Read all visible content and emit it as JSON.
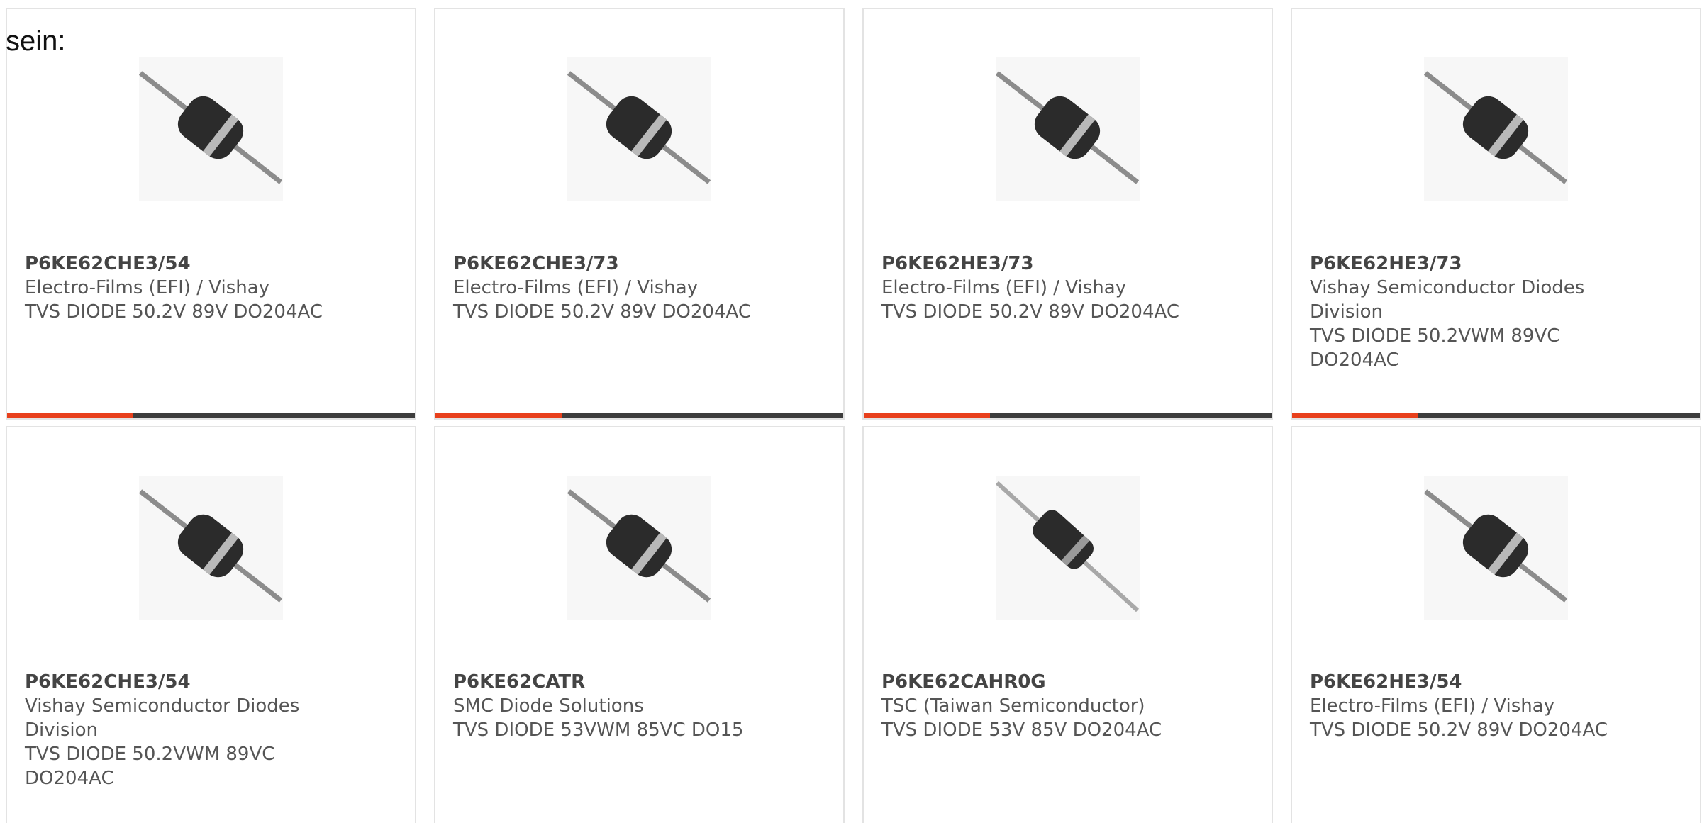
{
  "intro_text": "sein:",
  "colors": {
    "accent": "#e8401c",
    "bar_track": "#3d3d3d",
    "card_border": "#e3e3e3",
    "diode_body": "#2b2b2b",
    "diode_band": "#b9b9b9",
    "diode_lead": "#8c8c8c"
  },
  "products": [
    {
      "part_number": "P6KE62CHE3/54",
      "manufacturer": "Electro-Films (EFI) / Vishay",
      "description": "TVS DIODE 50.2V 89V DO204AC",
      "image_icon": "axial-diode-icon"
    },
    {
      "part_number": "P6KE62CHE3/73",
      "manufacturer": "Electro-Films (EFI) / Vishay",
      "description": "TVS DIODE 50.2V 89V DO204AC",
      "image_icon": "axial-diode-icon"
    },
    {
      "part_number": "P6KE62HE3/73",
      "manufacturer": "Electro-Films (EFI) / Vishay",
      "description": "TVS DIODE 50.2V 89V DO204AC",
      "image_icon": "axial-diode-icon"
    },
    {
      "part_number": "P6KE62HE3/73",
      "manufacturer": "Vishay Semiconductor Diodes Division",
      "description": "TVS DIODE 50.2VWM 89VC DO204AC",
      "image_icon": "axial-diode-icon"
    },
    {
      "part_number": "P6KE62CHE3/54",
      "manufacturer": "Vishay Semiconductor Diodes Division",
      "description": "TVS DIODE 50.2VWM 89VC DO204AC",
      "image_icon": "axial-diode-icon"
    },
    {
      "part_number": "P6KE62CATR",
      "manufacturer": "SMC Diode Solutions",
      "description": "TVS DIODE 53VWM 85VC DO15",
      "image_icon": "axial-diode-icon"
    },
    {
      "part_number": "P6KE62CAHR0G",
      "manufacturer": "TSC (Taiwan Semiconductor)",
      "description": "TVS DIODE 53V 85V DO204AC",
      "image_icon": "axial-diode-slim-icon"
    },
    {
      "part_number": "P6KE62HE3/54",
      "manufacturer": "Electro-Films (EFI) / Vishay",
      "description": "TVS DIODE 50.2V 89V DO204AC",
      "image_icon": "axial-diode-icon"
    }
  ],
  "progress_fraction": 0.31
}
